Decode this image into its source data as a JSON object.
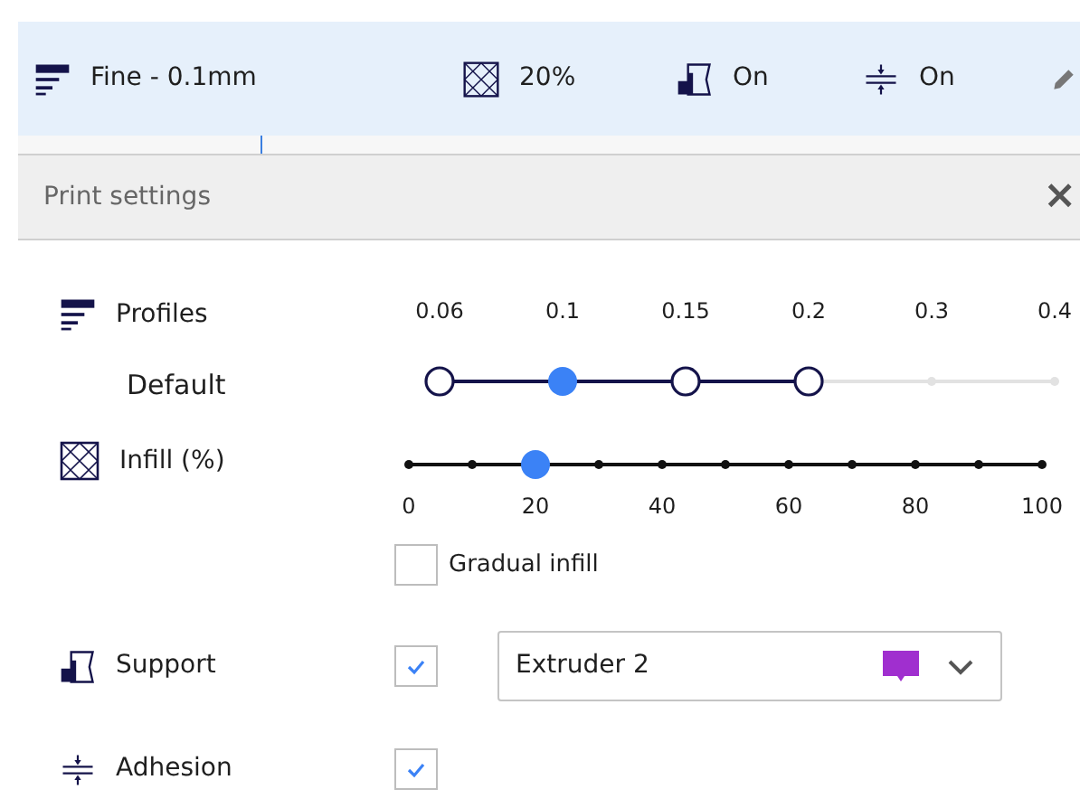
{
  "header": {
    "items": [
      {
        "kind": "profile",
        "label": "Fine - 0.1mm"
      },
      {
        "kind": "infill",
        "label": "20%"
      },
      {
        "kind": "support",
        "label": "On"
      },
      {
        "kind": "adhesion",
        "label": "On"
      },
      {
        "kind": "edit"
      }
    ]
  },
  "panel": {
    "title": "Print settings",
    "close": "×"
  },
  "profiles": {
    "label": "Profiles",
    "sublabel": "Default",
    "options": [
      {
        "label": "0.06",
        "available": true,
        "selected": false
      },
      {
        "label": "0.1",
        "available": true,
        "selected": true
      },
      {
        "label": "0.15",
        "available": true,
        "selected": false
      },
      {
        "label": "0.2",
        "available": true,
        "selected": false
      },
      {
        "label": "0.3",
        "available": false,
        "selected": false
      },
      {
        "label": "0.4",
        "available": false,
        "selected": false
      }
    ]
  },
  "infill": {
    "label": "Infill (%)",
    "level": 0.2,
    "ticks": [
      "0",
      "20",
      "40",
      "60",
      "80",
      "100"
    ],
    "gradual": {
      "label": "Gradual infill",
      "checked": false
    }
  },
  "support": {
    "label": "Support",
    "checked": true,
    "extruder": {
      "value": "Extruder 2",
      "color": "#a02fcf"
    }
  },
  "adhesion": {
    "label": "Adhesion",
    "checked": true
  }
}
